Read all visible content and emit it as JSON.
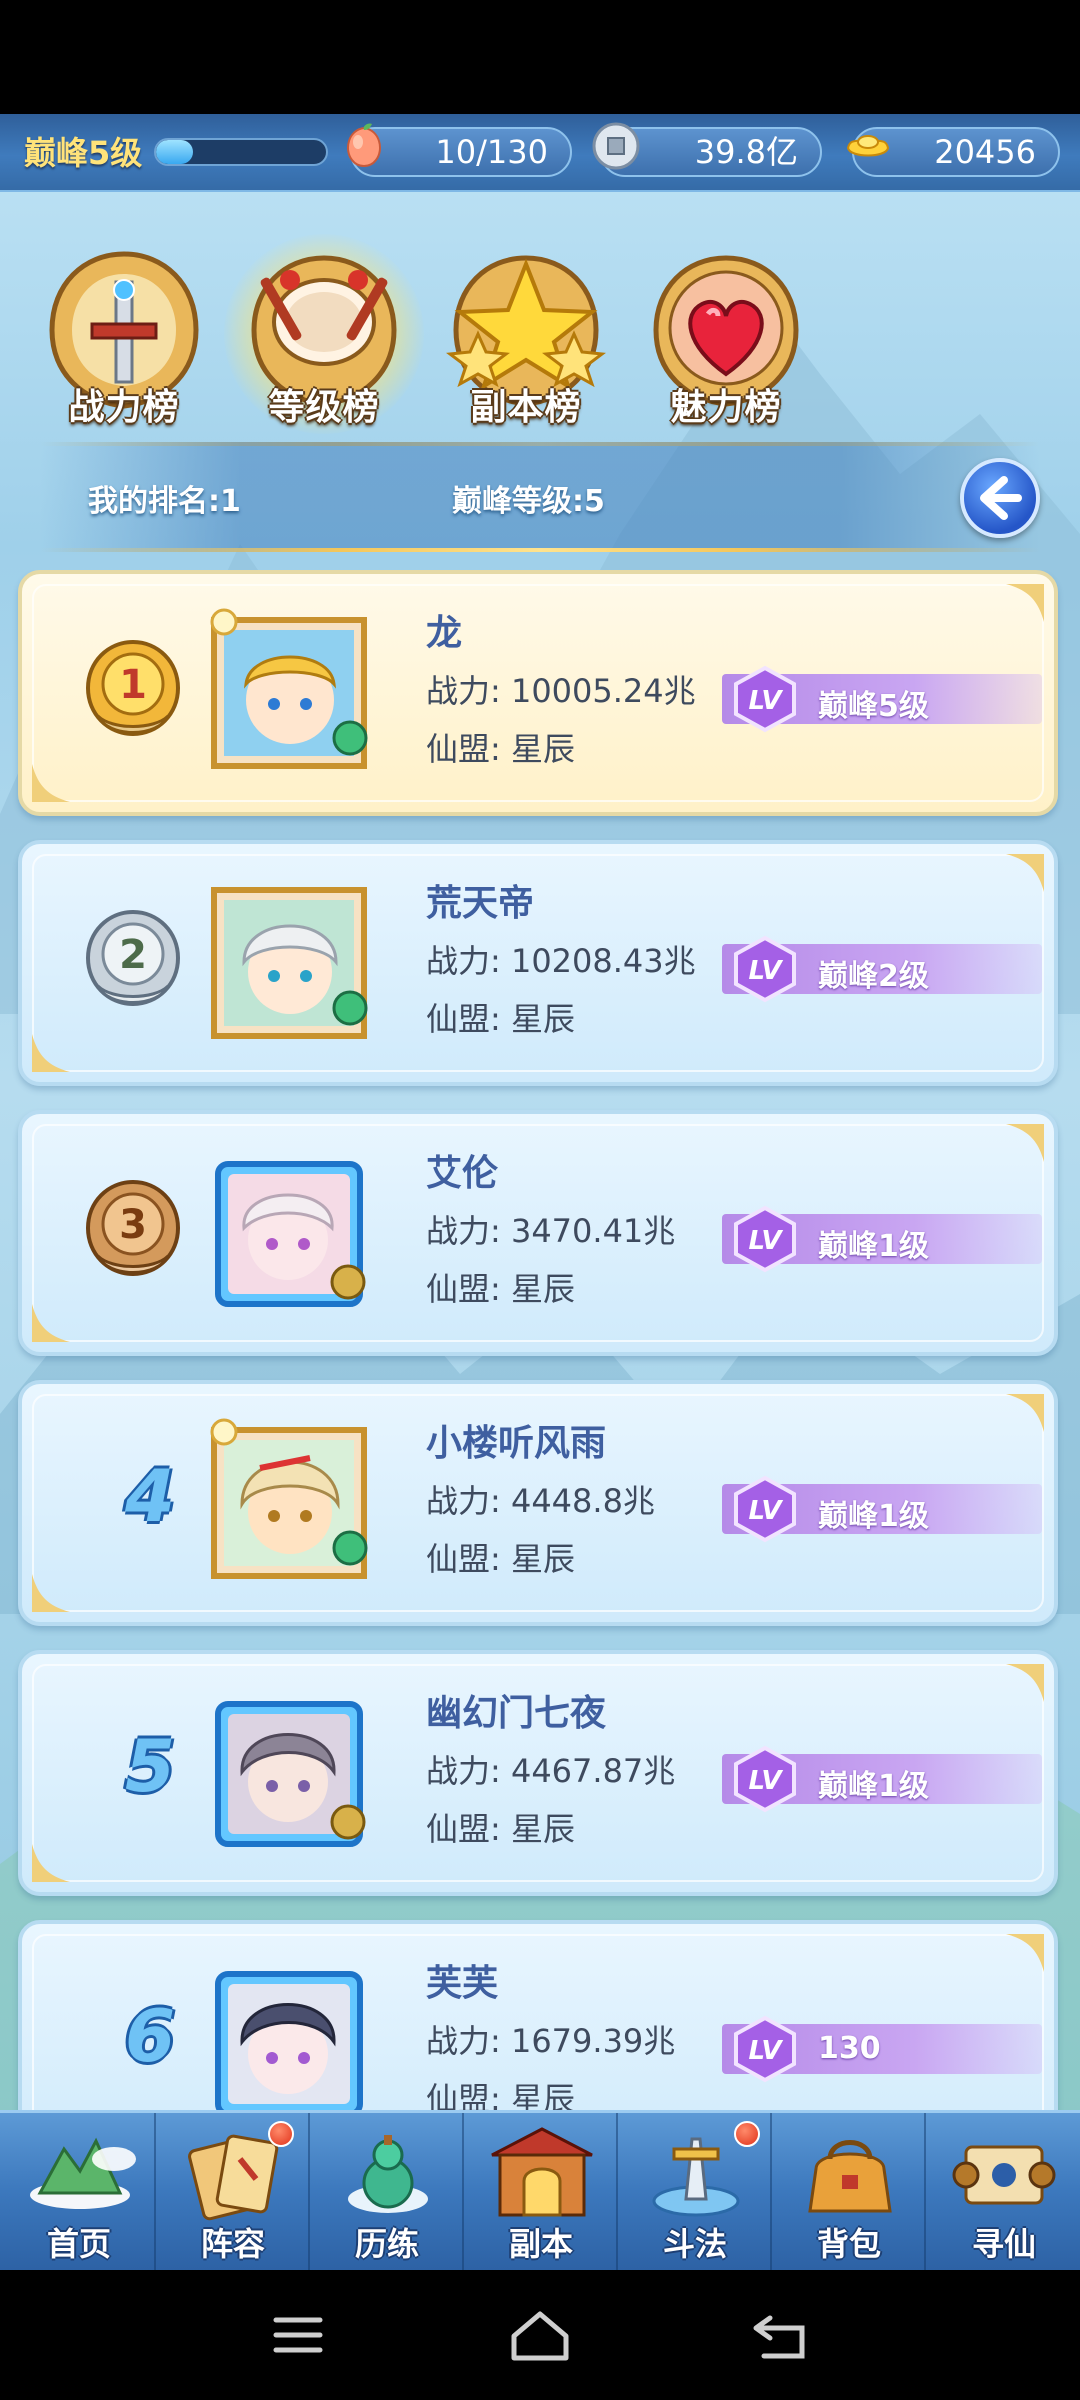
{
  "resources": {
    "peak_level": "巅峰5级",
    "xp_progress": 0.22,
    "stamina": "10/130",
    "silver": "39.8亿",
    "gold": "20456"
  },
  "tabs": [
    {
      "label": "战力榜",
      "icon": "sword-crest-icon",
      "active": false
    },
    {
      "label": "等级榜",
      "icon": "drum-crest-icon",
      "active": true
    },
    {
      "label": "副本榜",
      "icon": "star-crest-icon",
      "active": false
    },
    {
      "label": "魅力榜",
      "icon": "heart-crest-icon",
      "active": false
    }
  ],
  "my_rank": {
    "rank_text": "我的排名:1",
    "level_text": "巅峰等级:5"
  },
  "rankings": [
    {
      "rank": "1",
      "name": "龙",
      "power": "战力: 10005.24兆",
      "guild": "仙盟: 星辰",
      "level": "巅峰5级"
    },
    {
      "rank": "2",
      "name": "荒天帝",
      "power": "战力: 10208.43兆",
      "guild": "仙盟: 星辰",
      "level": "巅峰2级"
    },
    {
      "rank": "3",
      "name": "艾伦",
      "power": "战力: 3470.41兆",
      "guild": "仙盟: 星辰",
      "level": "巅峰1级"
    },
    {
      "rank": "4",
      "name": "小楼听风雨",
      "power": "战力: 4448.8兆",
      "guild": "仙盟: 星辰",
      "level": "巅峰1级"
    },
    {
      "rank": "5",
      "name": "幽幻门七夜",
      "power": "战力: 4467.87兆",
      "guild": "仙盟: 星辰",
      "level": "巅峰1级"
    },
    {
      "rank": "6",
      "name": "芙芙",
      "power": "战力: 1679.39兆",
      "guild": "仙盟: 星辰",
      "level": "130"
    }
  ],
  "lv_badge_text": "LV",
  "bottom_nav": [
    {
      "label": "首页",
      "icon": "home-island-icon",
      "dot": false
    },
    {
      "label": "阵容",
      "icon": "cards-icon",
      "dot": true
    },
    {
      "label": "历练",
      "icon": "gourd-icon",
      "dot": false
    },
    {
      "label": "副本",
      "icon": "dungeon-gate-icon",
      "dot": false
    },
    {
      "label": "斗法",
      "icon": "arena-icon",
      "dot": true
    },
    {
      "label": "背包",
      "icon": "bag-icon",
      "dot": false
    },
    {
      "label": "寻仙",
      "icon": "scroll-icon",
      "dot": false
    }
  ],
  "colors": {
    "accent_gold": "#f4c65a",
    "level_purple": "#b58ae8",
    "name_blue": "#3f5fa0"
  }
}
